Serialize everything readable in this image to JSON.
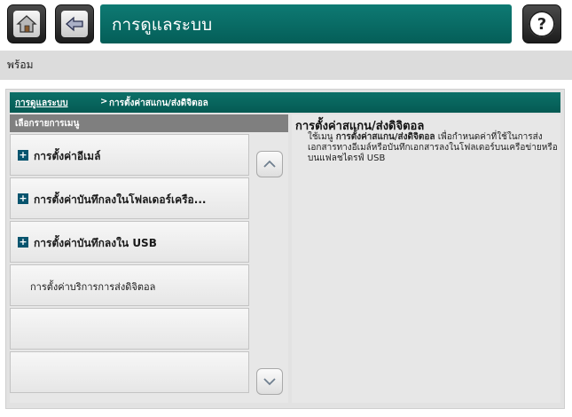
{
  "header": {
    "title": "การดูแลระบบ",
    "home_icon": "home-icon",
    "back_icon": "back-arrow-icon",
    "help_icon": "question-mark-icon"
  },
  "status": {
    "text": "พร้อม"
  },
  "breadcrumb": {
    "parent": "การดูแลระบบ",
    "separator": ">",
    "current": "การตั้งค่าสแกน/ส่งดิจิตอล"
  },
  "menu": {
    "header": "เลือกรายการเมนู",
    "items": [
      {
        "label": "การตั้งค่าอีเมล์",
        "expandable": true
      },
      {
        "label": "การตั้งค่าบันทึกลงในโฟลเดอร์เครือ...",
        "expandable": true
      },
      {
        "label": "การตั้งค่าบันทึกลงใน USB",
        "expandable": true
      },
      {
        "label": "การตั้งค่าบริการการส่งดิจิตอล",
        "expandable": false
      },
      {
        "label": "",
        "expandable": false
      },
      {
        "label": "",
        "expandable": false
      }
    ]
  },
  "info": {
    "title": "การตั้งค่าสแกน/ส่งดิจิตอล",
    "intro": "ใช้เมนู",
    "highlight": "การตั้งค่าสแกน/ส่งดิจิตอล",
    "description": "เพื่อกำหนดค่าที่ใช้ในการส่งเอกสารทางอีเมล์หรือบันทึกเอกสารลงในโฟลเดอร์บนเครือข่ายหรือบนแฟลชไดรฟ์ USB"
  },
  "colors": {
    "accent": "#067069",
    "expand_icon": "#07546e"
  }
}
